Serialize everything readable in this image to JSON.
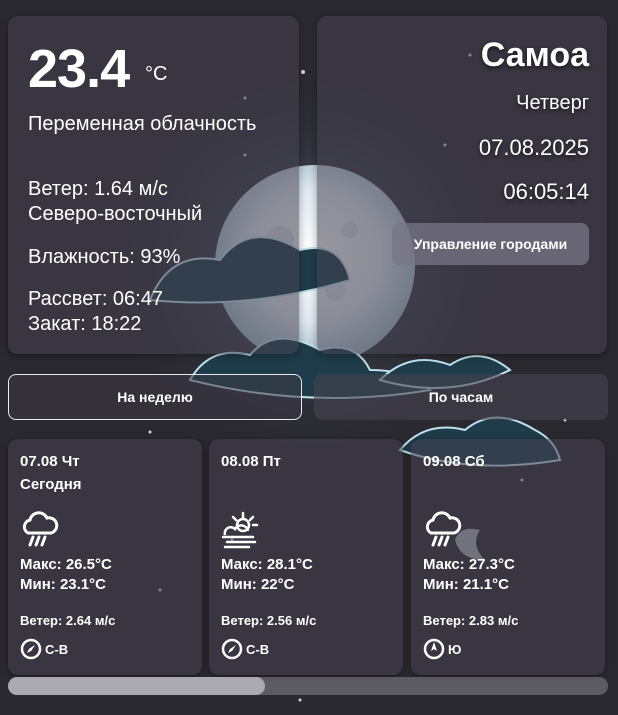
{
  "current": {
    "temperature": "23.4",
    "unit": "°C",
    "description": "Переменная облачность",
    "wind_line": "Ветер: 1.64 м/с",
    "wind_dir": "Северо-восточный",
    "humidity": "Влажность: 93%",
    "sunrise": "Рассвет: 06:47",
    "sunset": "Закат: 18:22"
  },
  "location": {
    "city": "Самоа",
    "weekday": "Четверг",
    "date": "07.08.2025",
    "time": "06:05:14",
    "manage_button": "Управление городами"
  },
  "tabs": {
    "week": "На неделю",
    "hourly": "По часам"
  },
  "forecast": [
    {
      "date": "07.08 Чт",
      "label": "Сегодня",
      "icon": "rain-cloud-icon",
      "max": "Макс: 26.5°C",
      "min": "Мин: 23.1°C",
      "wind": "Ветер: 2.64 м/с",
      "dir": "С-В"
    },
    {
      "date": "08.08 Пт",
      "label": "",
      "icon": "sun-fog-icon",
      "max": "Макс: 28.1°C",
      "min": "Мин: 22°C",
      "wind": "Ветер: 2.56 м/с",
      "dir": "С-В"
    },
    {
      "date": "09.08 Сб",
      "label": "",
      "icon": "rain-cloud-icon",
      "max": "Макс: 27.3°C",
      "min": "Мин: 21.1°C",
      "wind": "Ветер: 2.83 м/с",
      "dir": "Ю"
    }
  ],
  "scrollbar": {
    "position": 0
  }
}
